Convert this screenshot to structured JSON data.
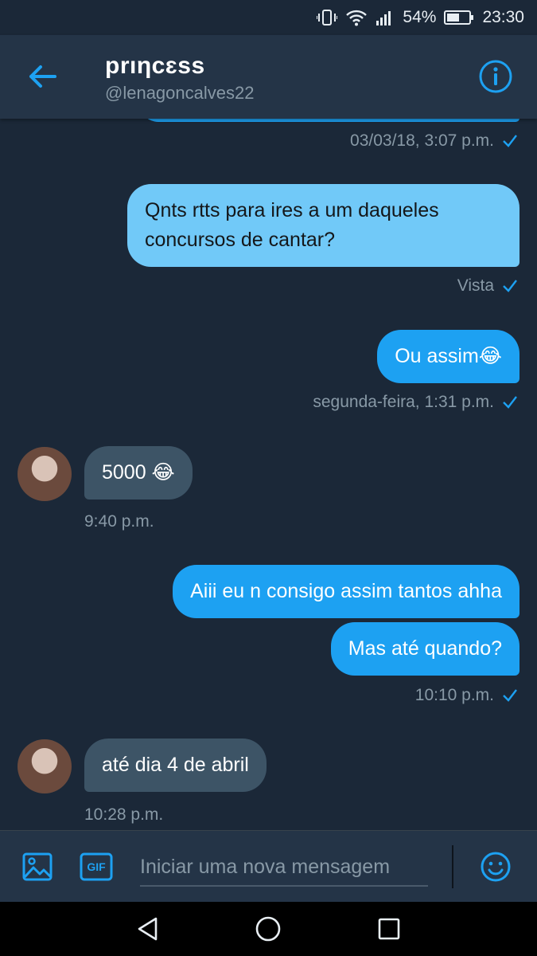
{
  "status_bar": {
    "battery": "54%",
    "time": "23:30"
  },
  "header": {
    "title": "prıηcɛss",
    "handle": "@lenagoncalves22"
  },
  "messages": [
    {
      "type": "meta",
      "side": "right",
      "text": "03/03/18, 3:07 p.m.",
      "check": true
    },
    {
      "type": "sent",
      "variant": "light",
      "text_lines": [
        "Qnts rtts para ires a um daqueles",
        "concursos de cantar?"
      ]
    },
    {
      "type": "meta",
      "side": "right",
      "text": "Vista",
      "check": true
    },
    {
      "type": "sent",
      "text": "Ou assim😂"
    },
    {
      "type": "meta",
      "side": "right",
      "text": "segunda-feira, 1:31 p.m.",
      "check": true
    },
    {
      "type": "received",
      "text": "5000 😂"
    },
    {
      "type": "meta",
      "side": "left",
      "text": "9:40 p.m."
    },
    {
      "type": "sent",
      "text": "Aiii eu n consigo assim tantos ahha"
    },
    {
      "type": "sent",
      "text": "Mas até quando?"
    },
    {
      "type": "meta",
      "side": "right",
      "text": "10:10 p.m.",
      "check": true
    },
    {
      "type": "received",
      "text": "até dia 4 de abril"
    },
    {
      "type": "meta",
      "side": "left",
      "text": "10:28 p.m."
    }
  ],
  "compose": {
    "placeholder": "Iniciar uma nova mensagem",
    "gif_label": "GIF"
  },
  "colors": {
    "accent": "#1da1f2",
    "background": "#1b2838",
    "header": "#243447",
    "received_bubble": "#3d5466"
  }
}
